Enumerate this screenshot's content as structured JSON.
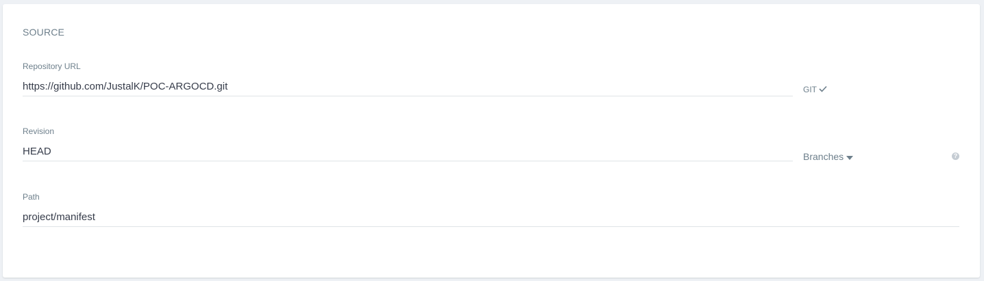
{
  "source": {
    "title": "SOURCE",
    "repo": {
      "label": "Repository URL",
      "value": "https://github.com/JustalK/POC-ARGOCD.git",
      "type_tag": "GIT",
      "type_icon": "check-icon"
    },
    "revision": {
      "label": "Revision",
      "value": "HEAD",
      "dropdown_label": "Branches",
      "dropdown_icon": "caret-down-icon",
      "help_icon": "question-icon",
      "help_glyph": "?"
    },
    "path": {
      "label": "Path",
      "value": "project/manifest"
    }
  }
}
